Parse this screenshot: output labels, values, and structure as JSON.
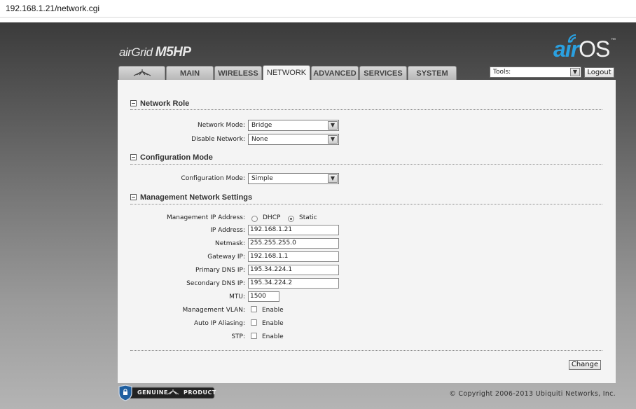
{
  "browser": {
    "url": "192.168.1.21/network.cgi"
  },
  "brand": {
    "product_air": "air",
    "product_grid": "Grid",
    "product_model": "M5HP",
    "os_air": "air",
    "os_os": "OS",
    "os_tm": "™",
    "accent": "#2aa0e0"
  },
  "tabs": [
    {
      "label": "",
      "icon": "ubiquiti-logo-icon"
    },
    {
      "label": "MAIN"
    },
    {
      "label": "WIRELESS"
    },
    {
      "label": "NETWORK",
      "active": true
    },
    {
      "label": "ADVANCED"
    },
    {
      "label": "SERVICES"
    },
    {
      "label": "SYSTEM"
    }
  ],
  "toolbar": {
    "tools_value": "Tools:",
    "logout_label": "Logout"
  },
  "network_role": {
    "title": "Network Role",
    "network_mode_label": "Network Mode:",
    "network_mode_value": "Bridge",
    "disable_network_label": "Disable Network:",
    "disable_network_value": "None"
  },
  "configuration_mode": {
    "title": "Configuration Mode",
    "config_mode_label": "Configuration Mode:",
    "config_mode_value": "Simple"
  },
  "management": {
    "title": "Management Network Settings",
    "mgmt_ip_label": "Management IP Address:",
    "dhcp_label": "DHCP",
    "static_label": "Static",
    "selected": "Static",
    "ip_label": "IP Address:",
    "ip_value": "192.168.1.21",
    "netmask_label": "Netmask:",
    "netmask_value": "255.255.255.0",
    "gateway_label": "Gateway IP:",
    "gateway_value": "192.168.1.1",
    "dns1_label": "Primary DNS IP:",
    "dns1_value": "195.34.224.1",
    "dns2_label": "Secondary DNS IP:",
    "dns2_value": "195.34.224.2",
    "mtu_label": "MTU:",
    "mtu_value": "1500",
    "vlan_label": "Management VLAN:",
    "vlan_enable": "Enable",
    "alias_label": "Auto IP Aliasing:",
    "alias_enable": "Enable",
    "stp_label": "STP:",
    "stp_enable": "Enable"
  },
  "actions": {
    "change_label": "Change"
  },
  "footer": {
    "badge_left": "GENUINE",
    "badge_right": "PRODUCT",
    "copyright": "© Copyright 2006-2013 Ubiquiti Networks, Inc."
  }
}
